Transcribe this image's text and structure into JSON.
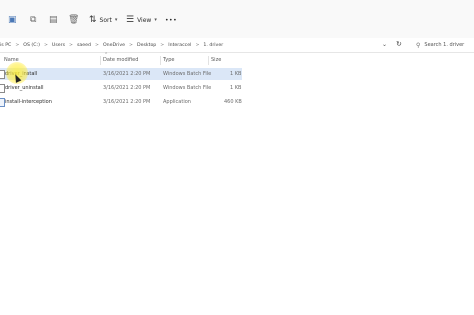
{
  "toolbar": {
    "items": [
      {
        "name": "new-icon"
      },
      {
        "name": "copy-icon"
      },
      {
        "name": "paste-icon"
      },
      {
        "name": "share-icon"
      },
      {
        "name": "delete-icon"
      }
    ],
    "sort_label": "Sort",
    "view_label": "View",
    "more_label": "•••"
  },
  "address": {
    "crumbs": [
      "is PC",
      "OS (C:)",
      "Users",
      "saeed",
      "OneDrive",
      "Desktop",
      "Interaccel",
      "1. driver"
    ],
    "separator": ">"
  },
  "search": {
    "placeholder": "Search 1. driver"
  },
  "columns": {
    "name": "Name",
    "date": "Date modified",
    "type": "Type",
    "size": "Size"
  },
  "files": [
    {
      "name": "driver_install",
      "date": "3/16/2021 2:20 PM",
      "type": "Windows Batch File",
      "size": "1 KB",
      "selected": true,
      "icon": "batch-file-icon"
    },
    {
      "name": "driver_uninstall",
      "date": "3/16/2021 2:20 PM",
      "type": "Windows Batch File",
      "size": "1 KB",
      "selected": false,
      "icon": "batch-file-icon"
    },
    {
      "name": "install-interception",
      "date": "3/16/2021 2:20 PM",
      "type": "Application",
      "size": "460 KB",
      "selected": false,
      "icon": "application-icon"
    }
  ],
  "colors": {
    "selection": "#dbe7f7",
    "cursor_highlight": "#ffeb3b"
  }
}
